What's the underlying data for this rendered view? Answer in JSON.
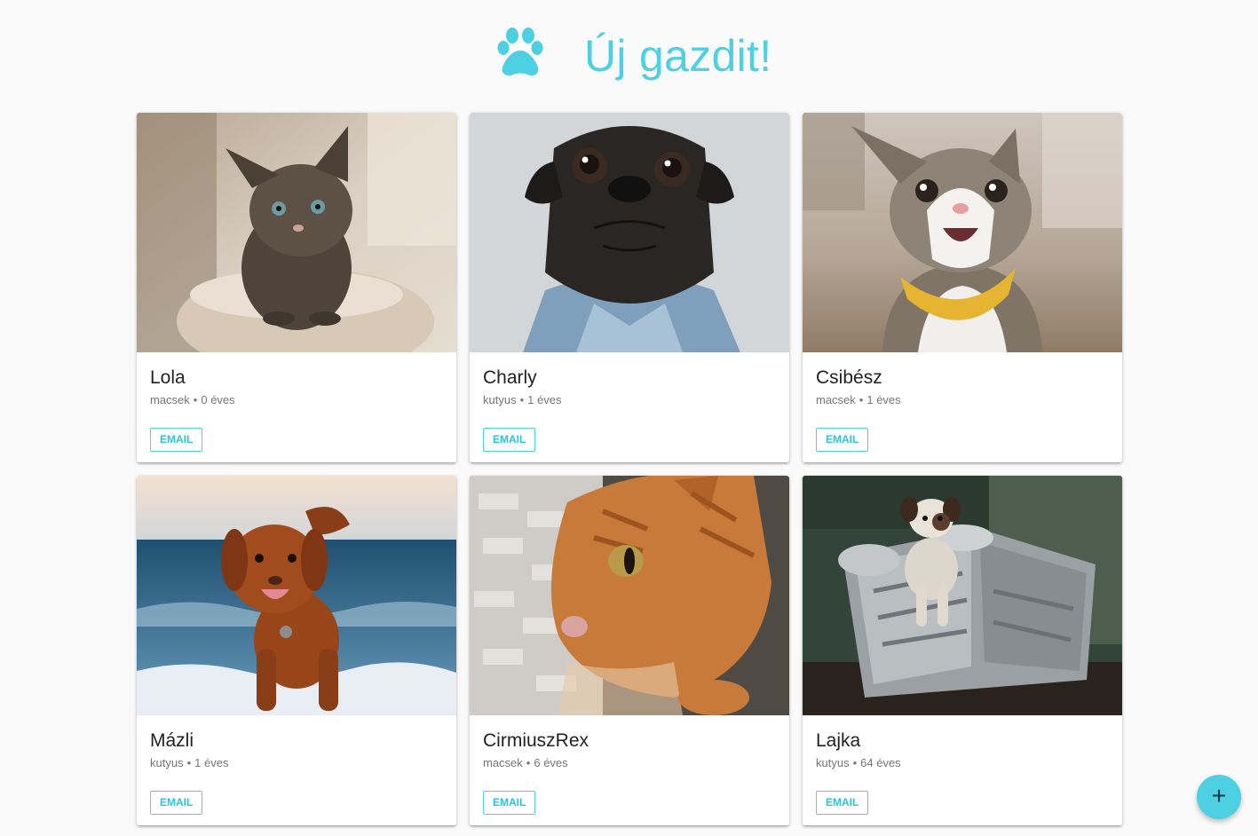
{
  "header": {
    "title": "Új gazdit!",
    "logo_icon": "paw-icon",
    "accent_color": "#4dd0e1"
  },
  "pets": [
    {
      "name": "Lola",
      "type": "macsek",
      "age": "0 éves",
      "button": "EMAIL",
      "photo": "kitten-tabby"
    },
    {
      "name": "Charly",
      "type": "kutyus",
      "age": "1 éves",
      "button": "EMAIL",
      "photo": "pug-denim-jacket"
    },
    {
      "name": "Csibész",
      "type": "macsek",
      "age": "1 éves",
      "button": "EMAIL",
      "photo": "cat-yellow-bandana"
    },
    {
      "name": "Mázli",
      "type": "kutyus",
      "age": "1 éves",
      "button": "EMAIL",
      "photo": "dog-running-beach"
    },
    {
      "name": "CirmiuszRex",
      "type": "macsek",
      "age": "6 éves",
      "button": "EMAIL",
      "photo": "orange-cat-wall"
    },
    {
      "name": "Lajka",
      "type": "kutyus",
      "age": "64 éves",
      "button": "EMAIL",
      "photo": "dog-space-capsule"
    }
  ],
  "fab": {
    "label": "+",
    "icon": "plus-icon"
  }
}
